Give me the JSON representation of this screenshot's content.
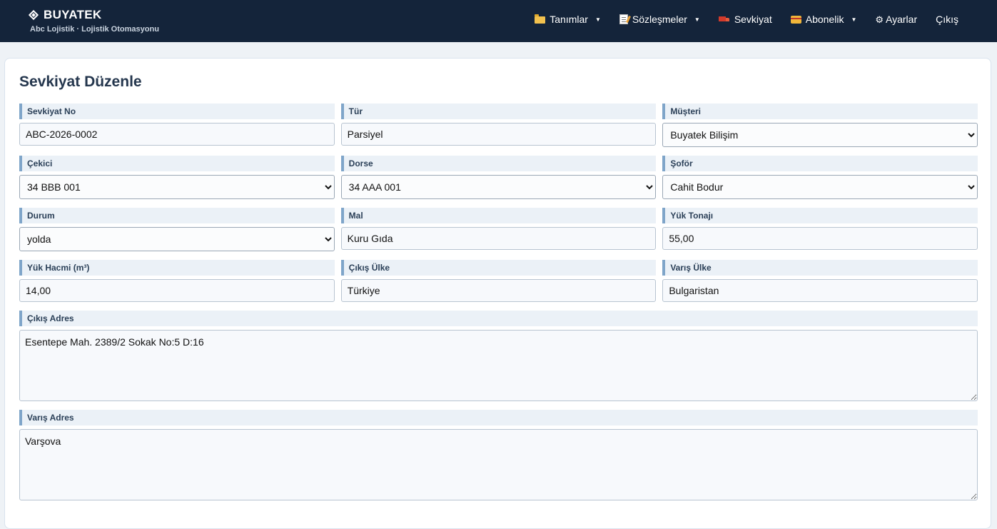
{
  "brand": {
    "name": "BUYATEK",
    "subtitle": "Abc Lojistik · Lojistik Otomasyonu"
  },
  "nav": {
    "items": [
      {
        "label": "Tanımlar",
        "icon": "folder-icon",
        "dropdown": true
      },
      {
        "label": "Sözleşmeler",
        "icon": "memo-icon",
        "dropdown": true
      },
      {
        "label": "Sevkiyat",
        "icon": "truck-icon",
        "dropdown": false
      },
      {
        "label": "Abonelik",
        "icon": "credit-card-icon",
        "dropdown": true
      },
      {
        "label": "Ayarlar",
        "icon": "gear-icon",
        "dropdown": false
      },
      {
        "label": "Çıkış",
        "icon": "",
        "dropdown": false
      }
    ],
    "caret": "▼",
    "gear_glyph": "⚙"
  },
  "page": {
    "title": "Sevkiyat Düzenle"
  },
  "form": {
    "sevkiyat_no": {
      "label": "Sevkiyat No",
      "value": "ABC-2026-0002"
    },
    "tur": {
      "label": "Tür",
      "value": "Parsiyel"
    },
    "musteri": {
      "label": "Müşteri",
      "value": "Buyatek Bilişim"
    },
    "cekici": {
      "label": "Çekici",
      "value": "34 BBB 001"
    },
    "dorse": {
      "label": "Dorse",
      "value": "34 AAA 001"
    },
    "sofor": {
      "label": "Şoför",
      "value": "Cahit Bodur"
    },
    "durum": {
      "label": "Durum",
      "value": "yolda"
    },
    "mal": {
      "label": "Mal",
      "value": "Kuru Gıda"
    },
    "yuk_tonaji": {
      "label": "Yük Tonajı",
      "value": "55,00"
    },
    "yuk_hacmi": {
      "label": "Yük Hacmi (m³)",
      "value": "14,00"
    },
    "cikis_ulke": {
      "label": "Çıkış Ülke",
      "value": "Türkiye"
    },
    "varis_ulke": {
      "label": "Varış Ülke",
      "value": "Bulgaristan"
    },
    "cikis_adres": {
      "label": "Çıkış Adres",
      "value": "Esentepe Mah. 2389/2 Sokak No:5 D:16"
    },
    "varis_adres": {
      "label": "Varış Adres",
      "value": "Varşova"
    }
  },
  "colors": {
    "topbar": "#14243a",
    "label_accent": "#7fa5c9",
    "label_bg": "#ebf1f7"
  }
}
